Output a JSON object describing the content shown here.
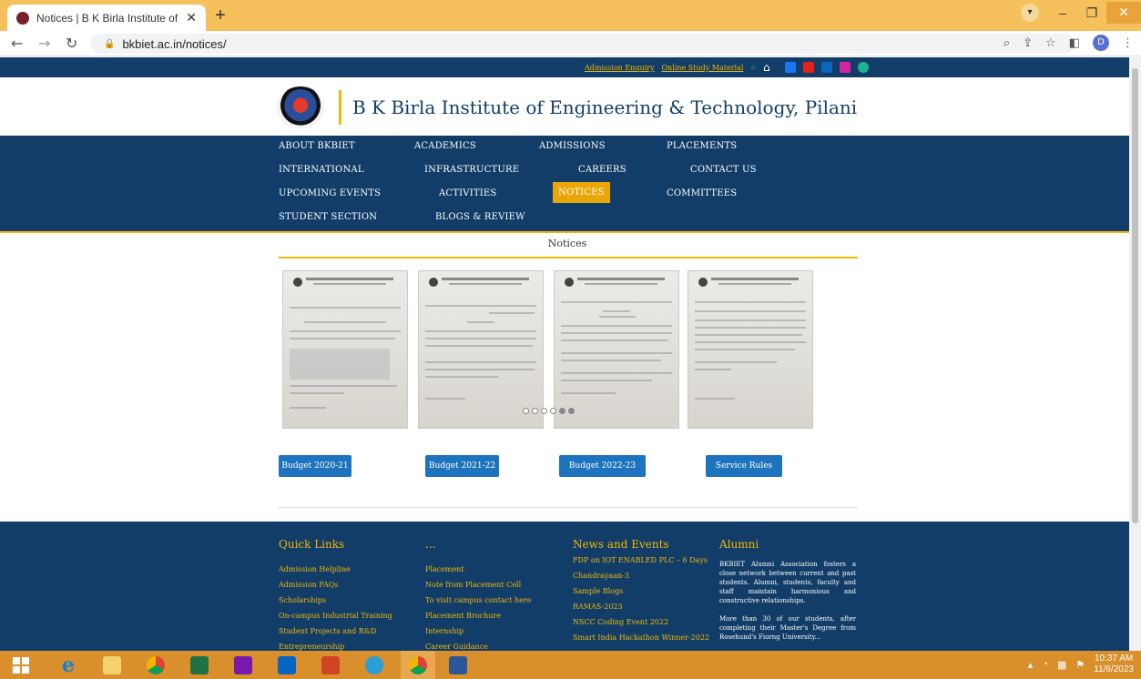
{
  "browser": {
    "tab_title": "Notices | B K Birla Institute of Eng",
    "tab_close": "✕",
    "new_tab": "+",
    "url": "bkbiet.ac.in/notices/",
    "profile_initial": "D",
    "win_minimize": "–",
    "win_restore": "❐",
    "win_close": "✕"
  },
  "site": {
    "top_links": [
      "Admission Enquiry",
      "Online Study Material"
    ],
    "social_icons": [
      "facebook-icon",
      "youtube-icon",
      "linkedin-icon",
      "instagram-icon",
      "extra-icon"
    ],
    "title": "B K Birla Institute of Engineering & Technology, Pilani",
    "nav": {
      "about": "ABOUT BKBIET",
      "academics": "ACADEMICS",
      "admissions": "ADMISSIONS",
      "placements": "PLACEMENTS",
      "international": "INTERNATIONAL",
      "infrastructure": "INFRASTRUCTURE",
      "careers": "CAREERS",
      "contact": "CONTACT US",
      "events": "UPCOMING EVENTS",
      "activities": "ACTIVITIES",
      "notices": "NOTICES",
      "committees": "COMMITTEES",
      "student": "STUDENT SECTION",
      "blogs": "BLOGS & REVIEW"
    },
    "section_title": "Notices",
    "buttons": [
      "Budget 2020-21",
      "Budget 2021-22",
      "Budget 2022-23",
      "Service Rules"
    ],
    "footer": {
      "quick_links_title": "Quick Links",
      "quick_links": [
        "Admission Helpline",
        "Admission FAQs",
        "Scholarships",
        "On-campus Industrial Training",
        "Student Projects and R&D",
        "Entrepreneurship"
      ],
      "col2_title": "...",
      "col2_links": [
        "Placement",
        "Note from Placement Cell",
        "To visit campus contact here",
        "Placement Brochure",
        "Internship",
        "Career Guidance"
      ],
      "news_title": "News and Events",
      "news": [
        "FDP on IOT ENABLED PLC – 6 Days",
        "Chandrayaan-3",
        "Sample Blogs",
        "RAMAS-2023",
        "NSCC Coding Event 2022",
        "Smart India Hackathon Winner-2022"
      ],
      "alumni_title": "Alumni",
      "alumni_p1": "BKBIET Alumni Association fosters a close network between current and past students. Alumni, students, faculty and staff maintain harmonious and constructive relationships.",
      "alumni_p2": "More than 30 of our students, after completing their Master's Degree from Rosehund's Fiorng University..."
    }
  },
  "taskbar": {
    "time": "10:37 AM",
    "date": "11/6/2023"
  }
}
